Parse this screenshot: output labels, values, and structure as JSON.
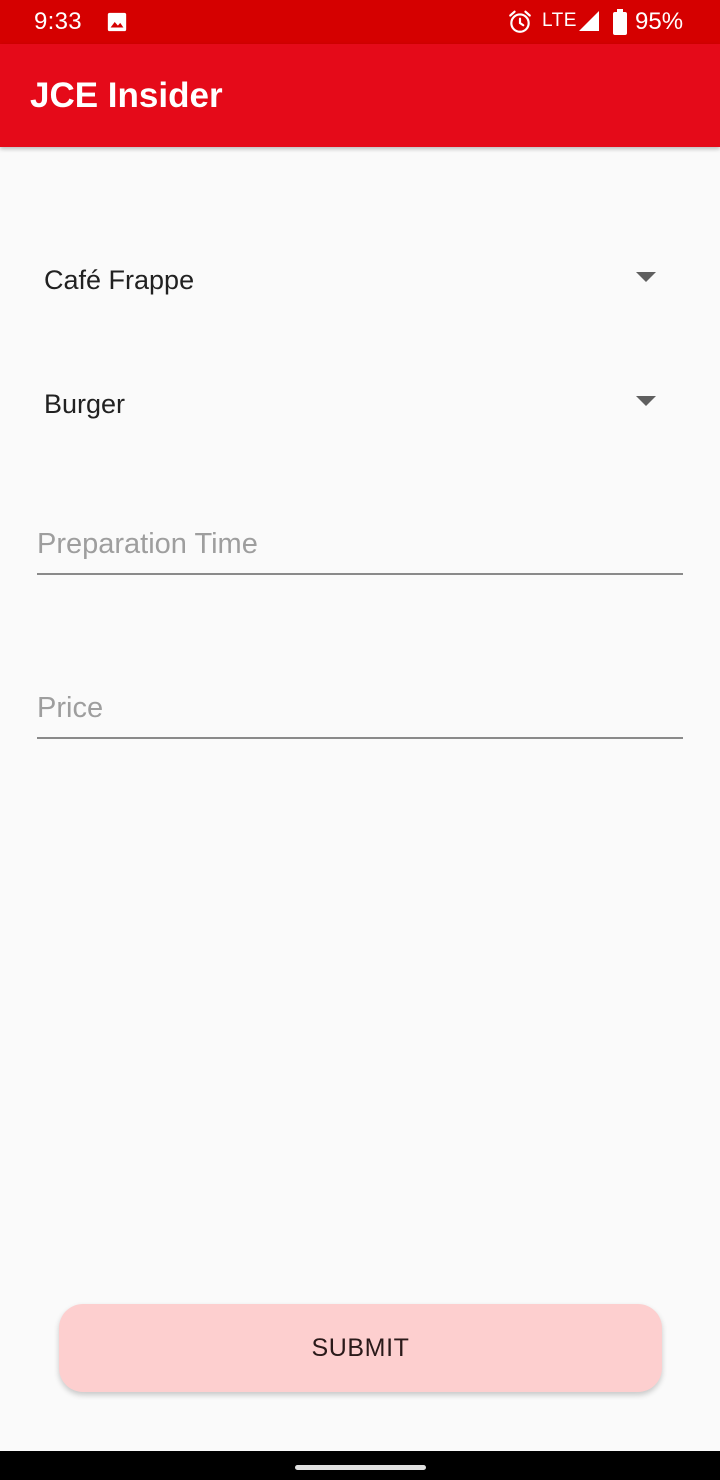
{
  "status_bar": {
    "time": "9:33",
    "network": "LTE",
    "battery": "95%",
    "icons": [
      "image-icon",
      "alarm-icon",
      "signal-icon",
      "battery-icon"
    ],
    "color": "#d50000"
  },
  "app_bar": {
    "title": "JCE Insider",
    "color": "#e50a19"
  },
  "form": {
    "spinner_1": {
      "selected": "Café Frappe",
      "icon": "dropdown-arrow-icon"
    },
    "spinner_2": {
      "selected": "Burger",
      "icon": "dropdown-arrow-icon"
    },
    "preparation_time": {
      "value": "",
      "placeholder": "Preparation Time"
    },
    "price": {
      "value": "",
      "placeholder": "Price"
    },
    "submit_label": "SUBMIT",
    "submit_color": "#fdcfcf"
  }
}
